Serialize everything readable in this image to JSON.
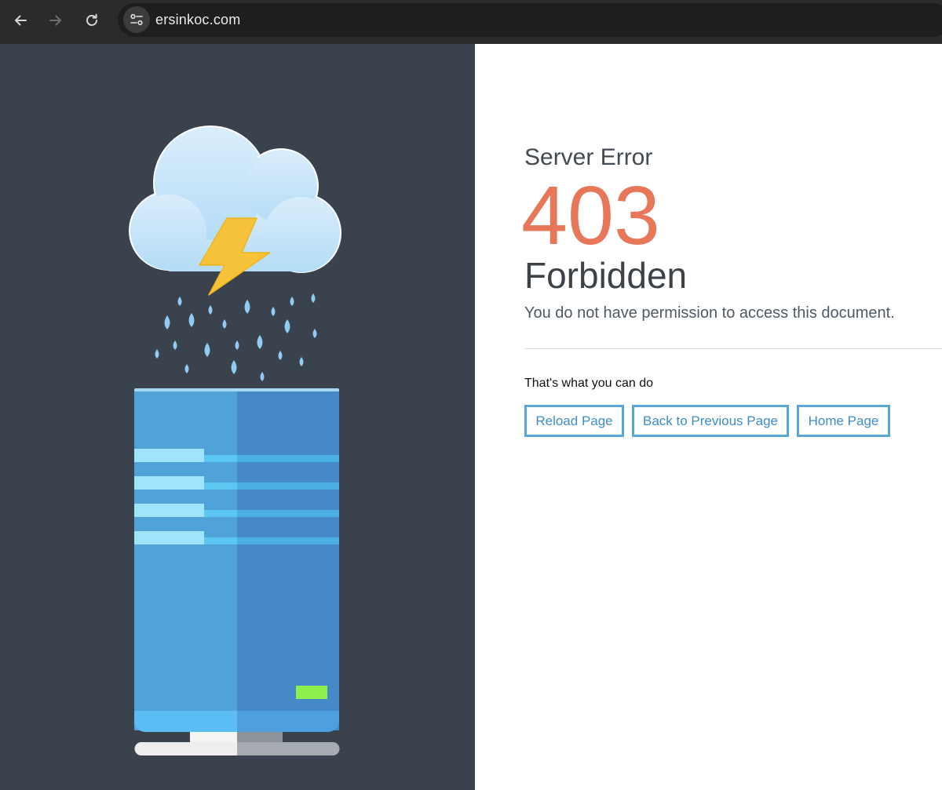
{
  "browser": {
    "url": "ersinkoc.com",
    "icons": [
      "back-arrow-icon",
      "forward-arrow-icon",
      "reload-icon",
      "site-info-icon"
    ]
  },
  "error": {
    "heading": "Server Error",
    "code": "403",
    "title": "Forbidden",
    "message": "You do not have permission to access this document.",
    "actions_label": "That's what you can do"
  },
  "actions": {
    "reload_label": "Reload Page",
    "back_label": "Back to Previous Page",
    "home_label": "Home Page"
  },
  "colors": {
    "panel": "#3a424d",
    "code": "#e8775a",
    "button_border": "#5aa6d6",
    "button_text": "#3f8dc5",
    "server_light": "#4fa3d9",
    "server_dark": "#4589c6",
    "led": "#8ef04a"
  }
}
